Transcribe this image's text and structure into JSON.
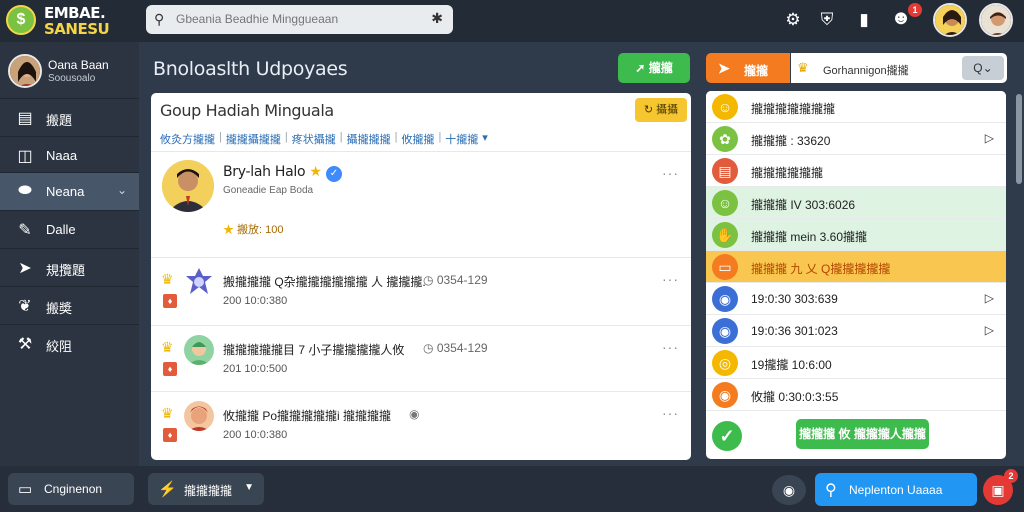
{
  "logo": {
    "line1": "EMBAE.",
    "line2": "SANESU"
  },
  "search": {
    "placeholder": "Gbeania Beadhie Minggueaan"
  },
  "topbar": {
    "icons": [
      "gear-icon",
      "shield-icon",
      "chat-icon",
      "notification-icon"
    ],
    "notification_count": "1"
  },
  "user": {
    "name": "Oana Baan",
    "subtitle": "Soousoalo"
  },
  "sidebar": {
    "items": [
      {
        "icon": "building-icon",
        "label": "搬題"
      },
      {
        "icon": "folder-icon",
        "label": "Naaa"
      },
      {
        "icon": "tag-icon",
        "label": "Neana"
      },
      {
        "icon": "edit-icon",
        "label": "Dalle"
      },
      {
        "icon": "run-icon",
        "label": "規攬題"
      },
      {
        "icon": "leaf-icon",
        "label": "搬奬"
      },
      {
        "icon": "wrench-icon",
        "label": "絞阻"
      }
    ]
  },
  "main": {
    "title": "Bnoloaslth Udpoyaes",
    "action_button": "攏攏",
    "card": {
      "title": "Goup Hadiah Minguala",
      "yellow_button": "攝攝",
      "tabs": [
        "攸灸方攏攏",
        "攏攏攝攏攏",
        "疼状攝攏",
        "攝攏攏攏",
        "攸攏攏",
        "十攏攏"
      ],
      "profile": {
        "name": "Bry-lah Halo",
        "subtitle": "Goneadie Eap Boda",
        "score": "搬放: 100"
      },
      "feed": [
        {
          "text": "搬攏攏攏 Q杂攏攏攏攏攏攏 人 攏攏攏.",
          "stat": "0354-129",
          "time": "200 10:0:380"
        },
        {
          "text": "攏攏攏攏攏目 7 小子攏攏攏攏人攸",
          "stat": "0354-129",
          "time": "201 10:0:500"
        },
        {
          "text": "攸攏攏 Po攏攏攏攏攏i 攏攏攏攏",
          "stat": "",
          "time": "200 10:0:380"
        }
      ]
    }
  },
  "right": {
    "orange_button": "攏攏",
    "search_text": "Gorhannigon攏攏",
    "search_button": "Q",
    "rows": [
      {
        "text": "攏攏攏攏攏攏攏",
        "color": "#f5b800",
        "icon": "smile-icon",
        "arrow": false,
        "highlight": "none"
      },
      {
        "text": "攏攏攏 : 33620",
        "color": "#7cc242",
        "icon": "flower-icon",
        "arrow": true,
        "highlight": "none"
      },
      {
        "text": "攏攏攏攏攏攏",
        "color": "#e25b3c",
        "icon": "card-icon",
        "arrow": false,
        "highlight": "none"
      },
      {
        "text": "攏攏攏 IV 303:6026",
        "color": "#7cc242",
        "icon": "smile-icon",
        "arrow": false,
        "highlight": "green"
      },
      {
        "text": "攏攏攏 mein 3.60攏攏",
        "color": "#7cc242",
        "icon": "hand-icon",
        "arrow": false,
        "highlight": "green"
      },
      {
        "text": "攏攏攏 九 乂 Q攏攏攏攏攏",
        "color": "#f47b20",
        "icon": "ticket-icon",
        "arrow": false,
        "highlight": "yellow"
      },
      {
        "text": "19:0:30 303:639",
        "color": "#3b6fd6",
        "icon": "badge-icon",
        "arrow": true,
        "highlight": "none"
      },
      {
        "text": "19:0:36 301:023",
        "color": "#3b6fd6",
        "icon": "badge-icon",
        "arrow": true,
        "highlight": "none"
      },
      {
        "text": "19攏攏 10:6:00",
        "color": "#f5b800",
        "icon": "coin-icon",
        "arrow": false,
        "highlight": "none"
      },
      {
        "text": "攸攏 0:30:0:3:55",
        "color": "#f47b20",
        "icon": "badge-icon",
        "arrow": false,
        "highlight": "none"
      }
    ],
    "confirm_button": "攏攏攏 攸 攏攏攏人攏攏"
  },
  "bottom": {
    "left_button": "Cnginenon",
    "middle_button": "攏攏攏攏",
    "blue_button": "Neplenton Uaaaa",
    "cart_count": "2"
  }
}
